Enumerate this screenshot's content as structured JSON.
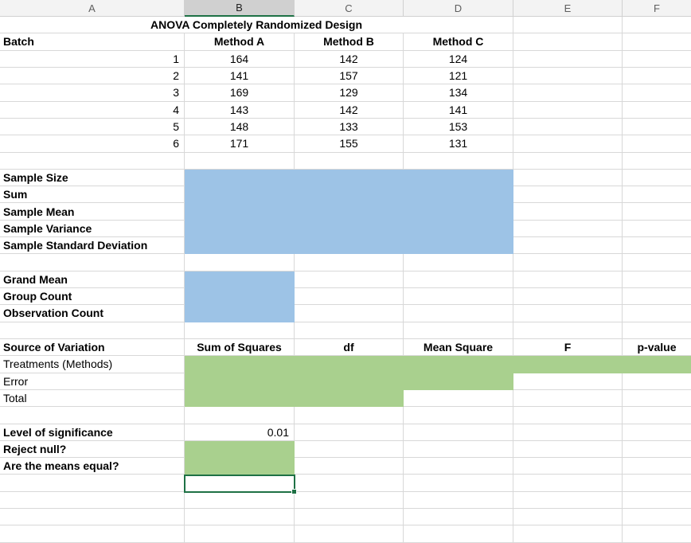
{
  "colors": {
    "fill_blue": "#9dc3e6",
    "fill_green": "#a9d08e",
    "selection_green": "#1e7145",
    "header_bg": "#f3f3f3",
    "header_active_bg": "#d0d0d0",
    "header_border": "#d0d0d0",
    "header_text": "#5e5e5e",
    "gridline": "#d8d8d8"
  },
  "column_headers": [
    "A",
    "B",
    "C",
    "D",
    "E",
    "F"
  ],
  "active_column": "B",
  "title": "ANOVA Completely Randomized Design",
  "data_table": {
    "corner_label": "Batch",
    "method_headers": [
      "Method A",
      "Method B",
      "Method C"
    ],
    "rows": [
      {
        "batch": "1",
        "values": [
          "164",
          "142",
          "124"
        ]
      },
      {
        "batch": "2",
        "values": [
          "141",
          "157",
          "121"
        ]
      },
      {
        "batch": "3",
        "values": [
          "169",
          "129",
          "134"
        ]
      },
      {
        "batch": "4",
        "values": [
          "143",
          "142",
          "141"
        ]
      },
      {
        "batch": "5",
        "values": [
          "148",
          "133",
          "153"
        ]
      },
      {
        "batch": "6",
        "values": [
          "171",
          "155",
          "131"
        ]
      }
    ]
  },
  "stats_labels": [
    "Sample Size",
    "Sum",
    "Sample Mean",
    "Sample Variance",
    "Sample Standard Deviation"
  ],
  "summary_labels": [
    "Grand Mean",
    "Group Count",
    "Observation Count"
  ],
  "anova_table": {
    "headers": [
      "Source of Variation",
      "Sum of Squares",
      "df",
      "Mean Square",
      "F",
      "p-value"
    ],
    "row_labels": [
      "Treatments (Methods)",
      "Error",
      "Total"
    ]
  },
  "significance": {
    "label": "Level of significance",
    "value": "0.01"
  },
  "questions": [
    "Reject null?",
    "Are the means equal?"
  ]
}
